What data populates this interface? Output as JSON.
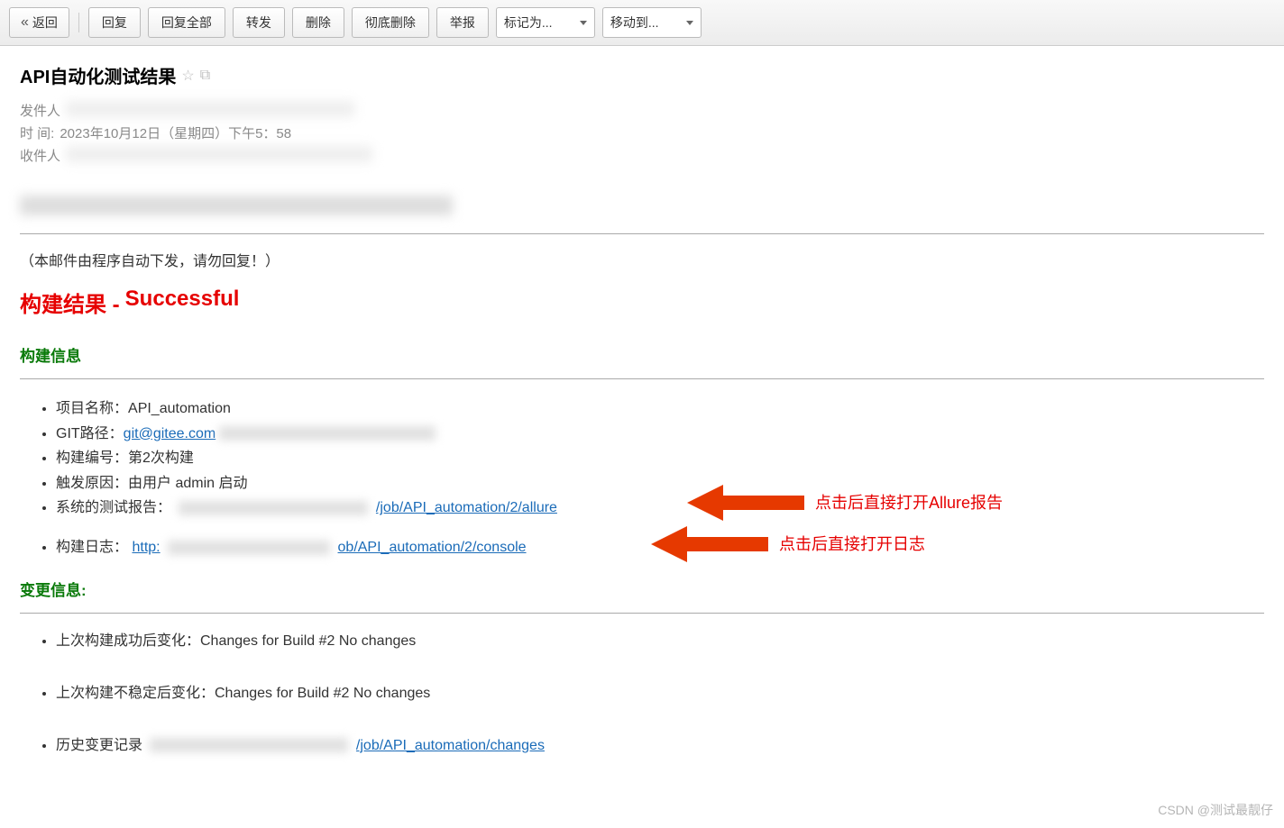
{
  "toolbar": {
    "back": "返回",
    "reply": "回复",
    "reply_all": "回复全部",
    "forward": "转发",
    "delete": "删除",
    "delete_perm": "彻底删除",
    "report": "举报",
    "mark_as": "标记为...",
    "move_to": "移动到..."
  },
  "subject": "API自动化测试结果",
  "meta": {
    "from_label": "发件人",
    "time_label": "时 间:",
    "time_value": "2023年10月12日（星期四）下午5：58",
    "to_label": "收件人"
  },
  "body": {
    "notice": "（本邮件由程序自动下发，请勿回复！）",
    "build_result_label": "构建结果 -",
    "build_result_value": "Successful",
    "build_info_heading": "构建信息",
    "project_name_label": "项目名称：",
    "project_name_value": "API_automation",
    "git_label": "GIT路径：",
    "git_value": "git@gitee.com",
    "build_no_label": "构建编号：",
    "build_no_value": "第2次构建",
    "trigger_label": "触发原因：",
    "trigger_value": "由用户 admin 启动",
    "report_label": "系统的测试报告：",
    "report_link": "/job/API_automation/2/allure",
    "log_label": "构建日志：",
    "log_prefix": "http:",
    "log_link": "ob/API_automation/2/console",
    "changes_heading": "变更信息:",
    "change_last_success": "上次构建成功后变化：Changes for Build #2 No changes",
    "change_last_unstable": "上次构建不稳定后变化：Changes for Build #2 No changes",
    "change_history_label": "历史变更记录",
    "change_history_link": "/job/API_automation/changes"
  },
  "annotations": {
    "allure": "点击后直接打开Allure报告",
    "log": "点击后直接打开日志"
  },
  "watermark": "CSDN @测试最靓仔"
}
